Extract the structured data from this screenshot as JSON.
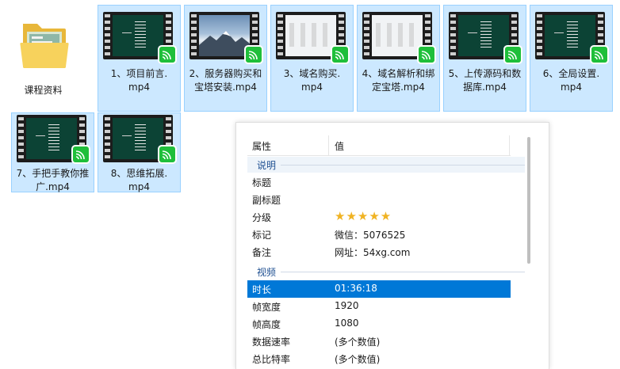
{
  "folder": {
    "label": "课程资料",
    "colors": {
      "back": "#e8b73a",
      "front": "#f7d25c"
    }
  },
  "files": [
    {
      "caption": "1、项目前言.\nmp4",
      "thumb": "dark"
    },
    {
      "caption": "2、服务器购买和\n宝塔安装.mp4",
      "thumb": "sky"
    },
    {
      "caption": "3、域名购买.\nmp4",
      "thumb": "light"
    },
    {
      "caption": "4、域名解析和绑\n定宝塔.mp4",
      "thumb": "light"
    },
    {
      "caption": "5、上传源码和数\n据库.mp4",
      "thumb": "dark"
    },
    {
      "caption": "6、全局设置.\nmp4",
      "thumb": "dark"
    },
    {
      "caption": "7、手把手教你推\n广.mp4",
      "thumb": "dark"
    },
    {
      "caption": "8、思维拓展.\nmp4",
      "thumb": "dark"
    }
  ],
  "badge": {
    "icon": "play-cast-icon",
    "color": "#1fbf3a"
  },
  "properties": {
    "col_name": "属性",
    "col_value": "值",
    "group_desc": "说明",
    "title_label": "标题",
    "subtitle_label": "副标题",
    "rating_label": "分级",
    "rating_value": 5,
    "rating_stars": "★★★★★",
    "tags_label": "标记",
    "tags_value": "微信：5076525",
    "comment_label": "备注",
    "comment_value": "网址：54xg.com",
    "group_video": "视频",
    "duration_label": "时长",
    "duration_value": "01:36:18",
    "width_label": "帧宽度",
    "width_value": "1920",
    "height_label": "帧高度",
    "height_value": "1080",
    "datarate_label": "数据速率",
    "datarate_value": "(多个数值)",
    "bitrate_label": "总比特率",
    "bitrate_value": "(多个数值)",
    "selection_color": "#0078d7"
  }
}
